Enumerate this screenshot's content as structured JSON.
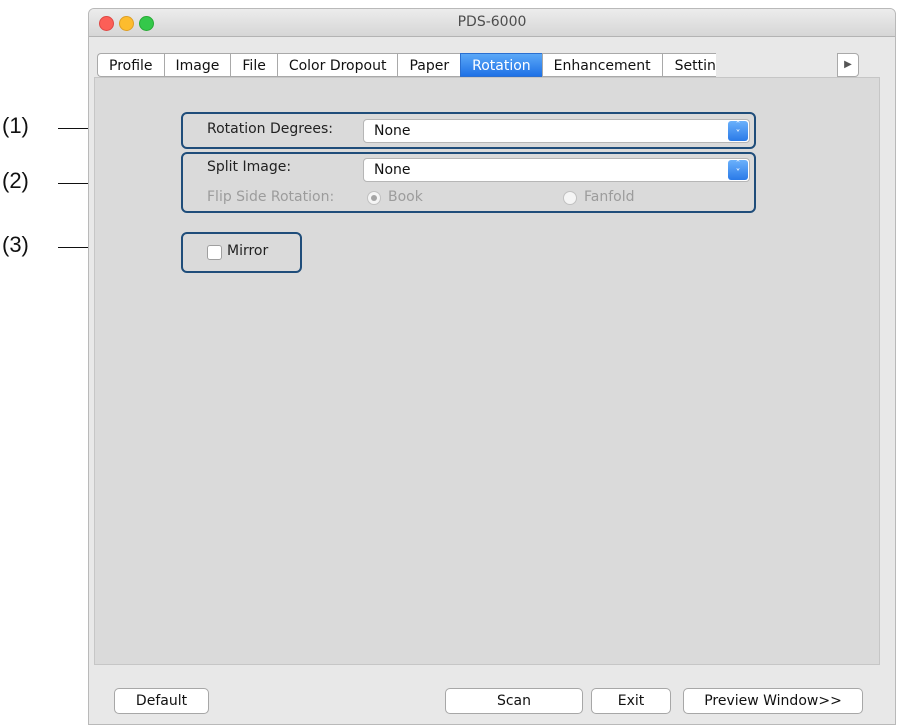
{
  "window": {
    "title": "PDS-6000"
  },
  "tabs": [
    {
      "label": "Profile"
    },
    {
      "label": "Image"
    },
    {
      "label": "File"
    },
    {
      "label": "Color Dropout"
    },
    {
      "label": "Paper"
    },
    {
      "label": "Rotation"
    },
    {
      "label": "Enhancement"
    },
    {
      "label": "Settings"
    }
  ],
  "active_tab": "Rotation",
  "rotation": {
    "degrees_label": "Rotation Degrees:",
    "degrees_value": "None",
    "split_label": "Split Image:",
    "split_value": "None",
    "flip_label": "Flip Side Rotation:",
    "flip_options": [
      {
        "label": "Book",
        "selected": true,
        "enabled": false
      },
      {
        "label": "Fanfold",
        "selected": false,
        "enabled": false
      }
    ],
    "mirror_label": "Mirror",
    "mirror_checked": false
  },
  "buttons": {
    "default": "Default",
    "scan": "Scan",
    "exit": "Exit",
    "preview": "Preview Window>>"
  },
  "callouts": [
    "(1)",
    "(2)",
    "(3)"
  ],
  "icons": {
    "tab_scroll": "triangle-right-icon",
    "select": "up-down-chevron-icon"
  },
  "colors": {
    "accent": "#1e71e6",
    "highlight_border": "#1f4d7a"
  }
}
